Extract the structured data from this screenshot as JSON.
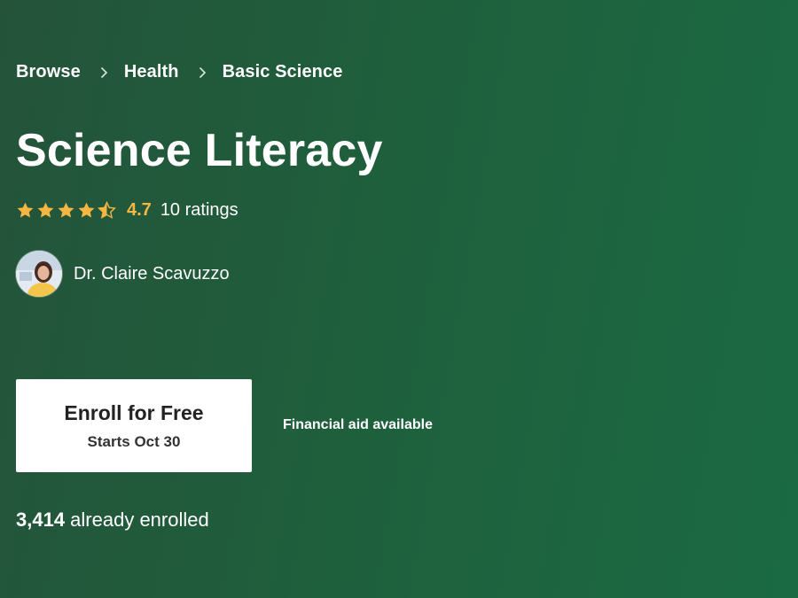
{
  "breadcrumb": {
    "items": [
      "Browse",
      "Health",
      "Basic Science"
    ]
  },
  "course": {
    "title": "Science Literacy"
  },
  "rating": {
    "value": "4.7",
    "stars": 4.5,
    "count_text": "10 ratings",
    "star_color": "#f5b642"
  },
  "instructor": {
    "name": "Dr. Claire Scavuzzo"
  },
  "enroll": {
    "label": "Enroll for Free",
    "start_text": "Starts Oct 30"
  },
  "financial_aid": {
    "text": "Financial aid available"
  },
  "enrollment": {
    "count": "3,414",
    "suffix": " already enrolled"
  },
  "colors": {
    "background_start": "#24533a",
    "background_end": "#1a6a43",
    "accent_star": "#f5b642",
    "button_bg": "#ffffff"
  }
}
